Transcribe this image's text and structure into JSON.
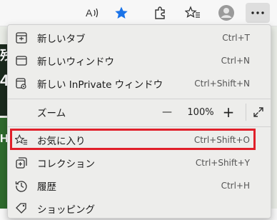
{
  "toolbar": {
    "buttons": [
      {
        "icon": "read-aloud-icon"
      },
      {
        "icon": "star-filled-icon"
      },
      {
        "icon": "extensions-icon"
      },
      {
        "icon": "favorites-bar-icon"
      },
      {
        "icon": "profile-icon"
      },
      {
        "icon": "more-icon"
      }
    ]
  },
  "menu": {
    "items": [
      {
        "label": "新しいタブ",
        "shortcut": "Ctrl+T",
        "icon": "new-tab-icon"
      },
      {
        "label": "新しいウィンドウ",
        "shortcut": "Ctrl+N",
        "icon": "new-window-icon"
      },
      {
        "label": "新しい InPrivate ウィンドウ",
        "shortcut": "Ctrl+Shift+N",
        "icon": "inprivate-icon"
      }
    ],
    "zoom": {
      "label": "ズーム",
      "minus": "—",
      "value": "100%",
      "plus": "+",
      "fullscreen_icon": "fullscreen-icon"
    },
    "items2": [
      {
        "label": "お気に入り",
        "shortcut": "Ctrl+Shift+O",
        "icon": "favorites-icon"
      },
      {
        "label": "コレクション",
        "shortcut": "Ctrl+Shift+Y",
        "icon": "collections-icon"
      },
      {
        "label": "履歴",
        "shortcut": "Ctrl+H",
        "icon": "history-icon"
      },
      {
        "label": "ショッピング",
        "shortcut": "",
        "icon": "shopping-icon"
      }
    ]
  },
  "background": {
    "glyph_top": "残",
    "glyph_mid": "4",
    "glyph_bot": "H"
  },
  "colors": {
    "accent": "#1a73e8",
    "highlight": "#e0202a",
    "menu_bg": "#ededeb"
  }
}
